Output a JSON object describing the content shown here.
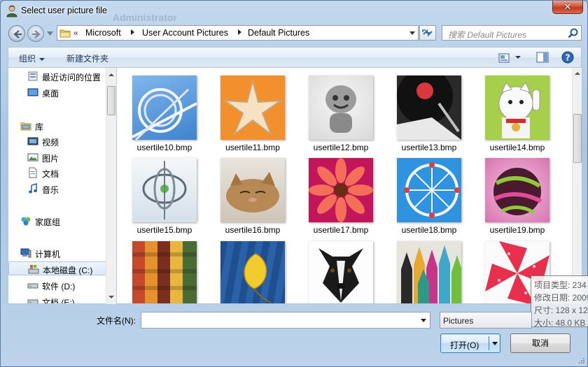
{
  "window": {
    "title": "Select user picture file",
    "ghost_text": "Administrator",
    "close_glyph": "✕"
  },
  "address": {
    "chevrons": "«",
    "crumbs": [
      "Microsoft",
      "User Account Pictures",
      "Default Pictures"
    ]
  },
  "search": {
    "placeholder": "搜索 Default Pictures"
  },
  "toolbar": {
    "organize": "组织",
    "new_folder": "新建文件夹"
  },
  "nav": {
    "items": [
      {
        "label": "最近访问的位置",
        "icon": "recent-places-icon"
      },
      {
        "label": "桌面",
        "icon": "desktop-icon"
      },
      {
        "label": "库",
        "icon": "libraries-icon"
      },
      {
        "label": "视频",
        "icon": "videos-icon"
      },
      {
        "label": "图片",
        "icon": "pictures-icon"
      },
      {
        "label": "文档",
        "icon": "documents-icon"
      },
      {
        "label": "音乐",
        "icon": "music-icon"
      },
      {
        "label": "家庭组",
        "icon": "homegroup-icon"
      },
      {
        "label": "计算机",
        "icon": "computer-icon"
      },
      {
        "label": "本地磁盘 (C:)",
        "icon": "local-disk-icon"
      },
      {
        "label": "软件 (D:)",
        "icon": "drive-icon"
      },
      {
        "label": "文档 (E:)",
        "icon": "drive-icon"
      }
    ]
  },
  "files": [
    {
      "label": "usertile10.bmp"
    },
    {
      "label": "usertile11.bmp"
    },
    {
      "label": "usertile12.bmp"
    },
    {
      "label": "usertile13.bmp"
    },
    {
      "label": "usertile14.bmp"
    },
    {
      "label": "usertile15.bmp"
    },
    {
      "label": "usertile16.bmp"
    },
    {
      "label": "usertile17.bmp"
    },
    {
      "label": "usertile18.bmp"
    },
    {
      "label": "usertile19.bmp"
    },
    {
      "label": ""
    },
    {
      "label": ""
    },
    {
      "label": ""
    },
    {
      "label": ""
    },
    {
      "label": ""
    }
  ],
  "tooltip": {
    "lines": [
      "项目类型: 234",
      "修改日期: 2009",
      "尺寸: 128 x 12",
      "大小: 48.0 KB"
    ]
  },
  "footer": {
    "filename_label": "文件名(N):",
    "filename_value": "",
    "filter_value": "Pictures",
    "open_label": "打开(O)",
    "cancel_label": "取消"
  }
}
